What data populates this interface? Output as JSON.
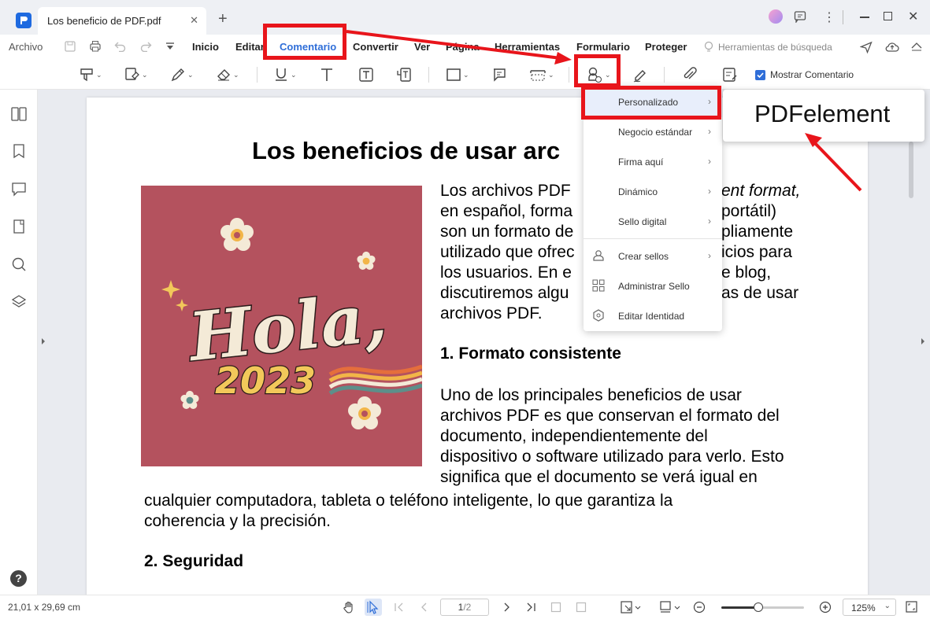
{
  "app": {
    "tab_title": "Los beneficio de PDF.pdf",
    "tab_close": "✕",
    "new_tab": "+"
  },
  "menubar": {
    "items": [
      "Archivo",
      "Inicio",
      "Editar",
      "Comentario",
      "Convertir",
      "Ver",
      "Página",
      "Herramientas",
      "Formulario",
      "Proteger"
    ],
    "search_tools": "Herramientas de búsqueda",
    "active": "Comentario"
  },
  "toolbar": {
    "show_comments_label": "Mostrar Comentario",
    "show_comments_checked": true
  },
  "document": {
    "title": "Los beneficios de usar arc",
    "para1": [
      "Los archivos PDF",
      "en español, forma",
      "son un formato de",
      "utilizado que ofrec",
      "los usuarios. En e",
      "discutiremos algu",
      "archivos PDF."
    ],
    "para1_right": [
      "ent format,",
      "portátil)",
      "pliamente",
      "icios para",
      "e blog,",
      "as de usar"
    ],
    "heading1": "1. Formato consistente",
    "para2": [
      "Uno de los principales beneficios de usar",
      "archivos PDF es que conservan el formato del",
      "documento, independientemente del",
      "dispositivo o software utilizado para verlo. Esto",
      "significa que el documento se verá igual en"
    ],
    "para2_full": [
      "cualquier computadora, tableta o teléfono inteligente, lo que garantiza la",
      "coherencia y la precisión."
    ],
    "heading2": "2. Seguridad",
    "image_text": "Hola,",
    "image_year": "2023"
  },
  "stamp_menu": {
    "items": [
      {
        "label": "Personalizado",
        "arrow": true,
        "icon": ""
      },
      {
        "label": "Negocio estándar",
        "arrow": true,
        "icon": ""
      },
      {
        "label": "Firma aquí",
        "arrow": true,
        "icon": ""
      },
      {
        "label": "Dinámico",
        "arrow": true,
        "icon": ""
      },
      {
        "label": "Sello digital",
        "arrow": true,
        "icon": ""
      },
      {
        "label": "Crear sellos",
        "arrow": true,
        "icon": "user-stamp-icon"
      },
      {
        "label": "Administrar Sello",
        "arrow": false,
        "icon": "grid-icon"
      },
      {
        "label": "Editar Identidad",
        "arrow": false,
        "icon": "hexagon-icon"
      }
    ],
    "selected": "Personalizado"
  },
  "sub_popup": {
    "label": "PDFelement"
  },
  "statusbar": {
    "page_size": "21,01 x 29,69 cm",
    "page_input": "1",
    "page_total": "/2",
    "zoom": "125%",
    "zoom_slider": 0.3
  },
  "colors": {
    "accent": "#2f6ed8",
    "annotation_red": "#e8151b",
    "image_bg": "#b4525e"
  }
}
